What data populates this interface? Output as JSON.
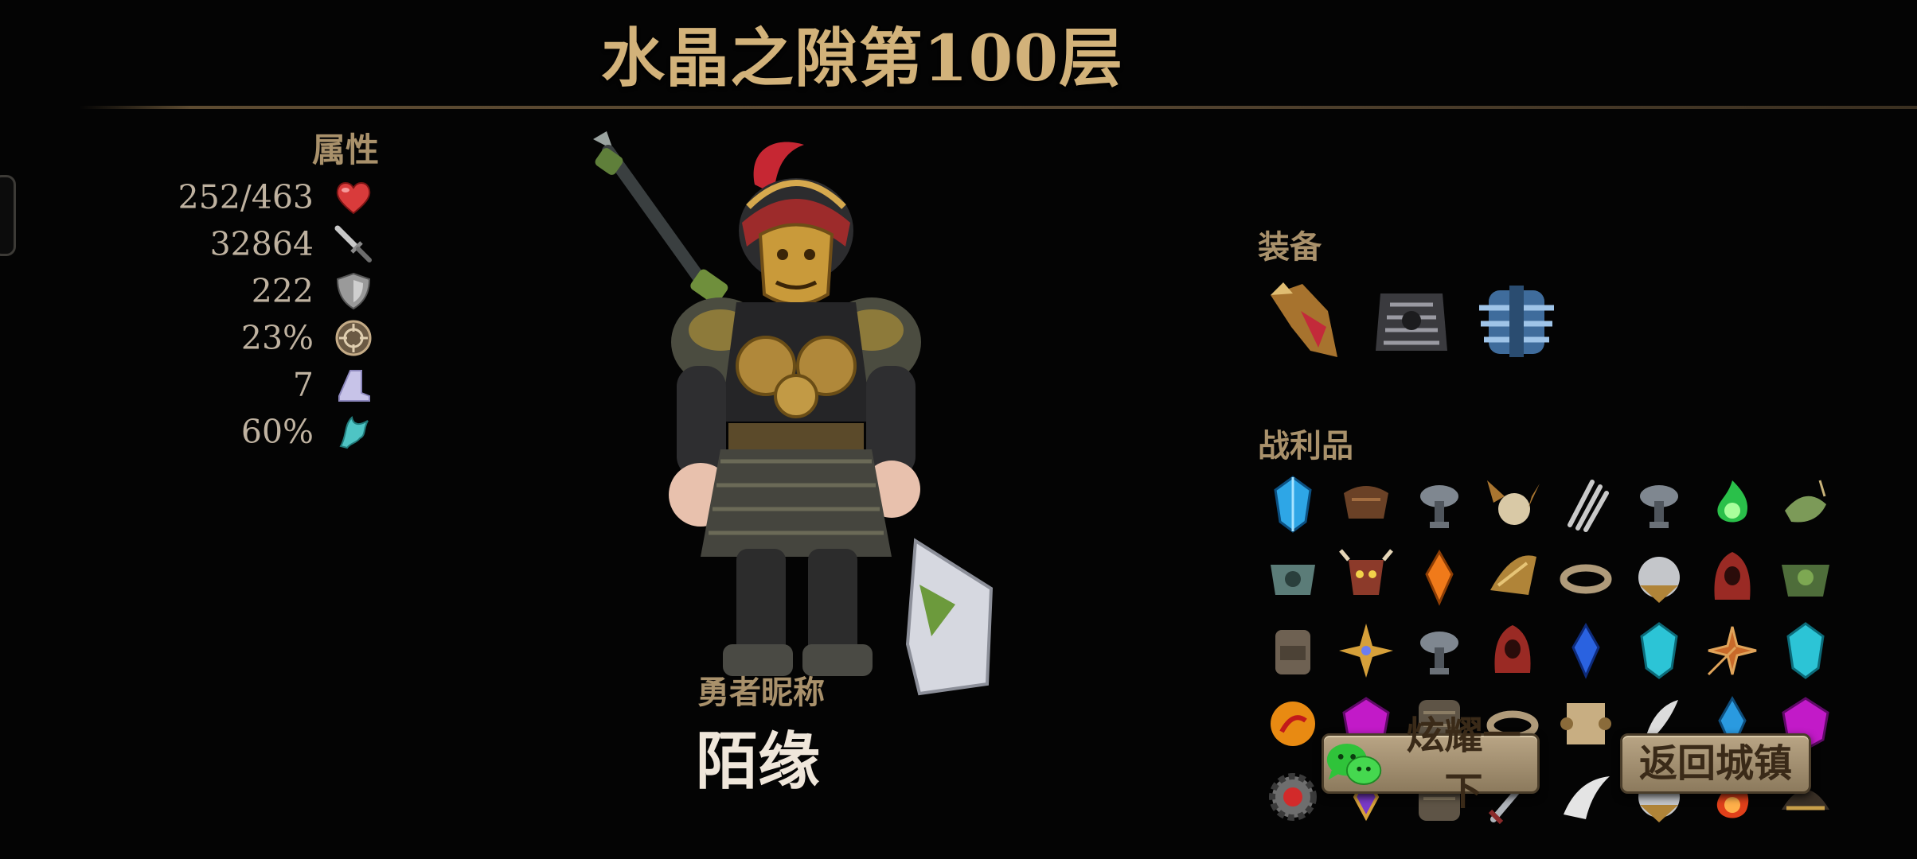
{
  "header": {
    "title": "水晶之隙第100层"
  },
  "attributes": {
    "title": "属性",
    "stats": [
      {
        "value": "252/463",
        "icon": "heart-icon"
      },
      {
        "value": "32864",
        "icon": "sword-icon"
      },
      {
        "value": "222",
        "icon": "shield-icon"
      },
      {
        "value": "23%",
        "icon": "crit-icon"
      },
      {
        "value": "7",
        "icon": "boot-icon"
      },
      {
        "value": "60%",
        "icon": "dodge-icon"
      }
    ]
  },
  "hero": {
    "nickname_label": "勇者昵称",
    "nickname": "陌缘"
  },
  "equipment": {
    "title": "装备",
    "items": [
      "weapon-icon",
      "armor-icon",
      "blue-armor-icon"
    ]
  },
  "loot": {
    "title": "战利品",
    "rows": [
      [
        "blue-gem-icon",
        "brown-cape-icon",
        "gray-helmet-icon",
        "horned-orb-icon",
        "claw-icon",
        "gray-helmet-icon",
        "green-flame-icon",
        "green-amulet-icon"
      ],
      [
        "jade-armor-icon",
        "mask-icon",
        "orange-crystal-icon",
        "golden-helmet-icon",
        "ring-icon",
        "silver-orb-icon",
        "red-hood-icon",
        "green-armor-icon"
      ],
      [
        "backpack-icon",
        "shuriken-icon",
        "gray-helmet-icon",
        "red-hood-icon",
        "blue-crystal-icon",
        "cyan-gem-icon",
        "star-blade-icon",
        "cyan-gem-icon"
      ],
      [
        "fire-orb-icon",
        "purple-gem-icon",
        "leather-armor-icon",
        "ring-icon",
        "scroll-icon",
        "feather-icon",
        "blue-crystal-icon",
        "purple-gem-icon"
      ],
      [
        "gear-icon",
        "purple-amulet-icon",
        "leather-armor-icon",
        "dagger-icon",
        "horn-icon",
        "silver-orb-icon",
        "fire-icon",
        "fire-icon",
        "dark-helmet-icon"
      ]
    ]
  },
  "buttons": {
    "share": "炫耀一下",
    "return": "返回城镇"
  },
  "colors": {
    "accent": "#d2b27a",
    "panel_text": "#a9916b",
    "button": "#a89474"
  }
}
